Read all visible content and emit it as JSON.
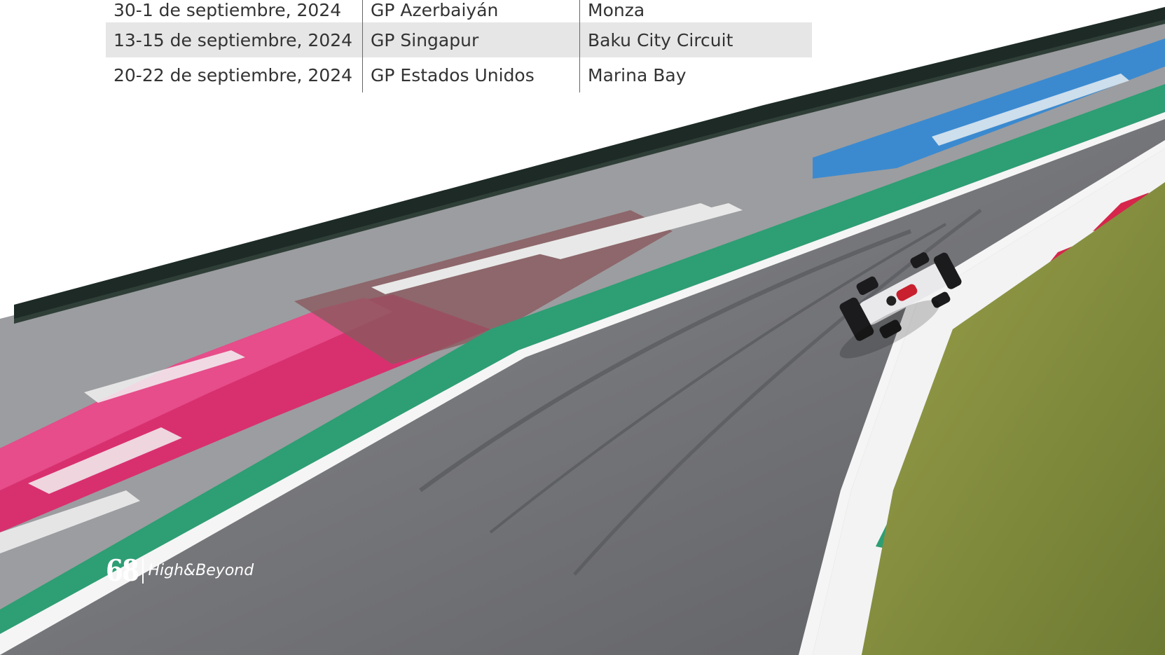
{
  "schedule": {
    "rows": [
      {
        "date": "30-1 de septiembre, 2024",
        "grand_prix": "GP Azerbaiyán",
        "circuit": "Monza"
      },
      {
        "date": "13-15 de septiembre, 2024",
        "grand_prix": "GP Singapur",
        "circuit": "Baku City Circuit"
      },
      {
        "date": "20-22 de septiembre, 2024",
        "grand_prix": "GP Estados Unidos",
        "circuit": "Marina Bay"
      }
    ]
  },
  "footer": {
    "page_number": "68",
    "magazine_name": "High&Beyond"
  },
  "colors": {
    "table_stripe": "#e6e6e6",
    "text": "#333333",
    "asphalt": "#6a6b6f",
    "kerb_green": "#2e9e74",
    "runoff_pink": "#e0337a",
    "grass": "#7f8a3a"
  },
  "photo": {
    "subject": "Formula 1 car at Monza circuit"
  }
}
